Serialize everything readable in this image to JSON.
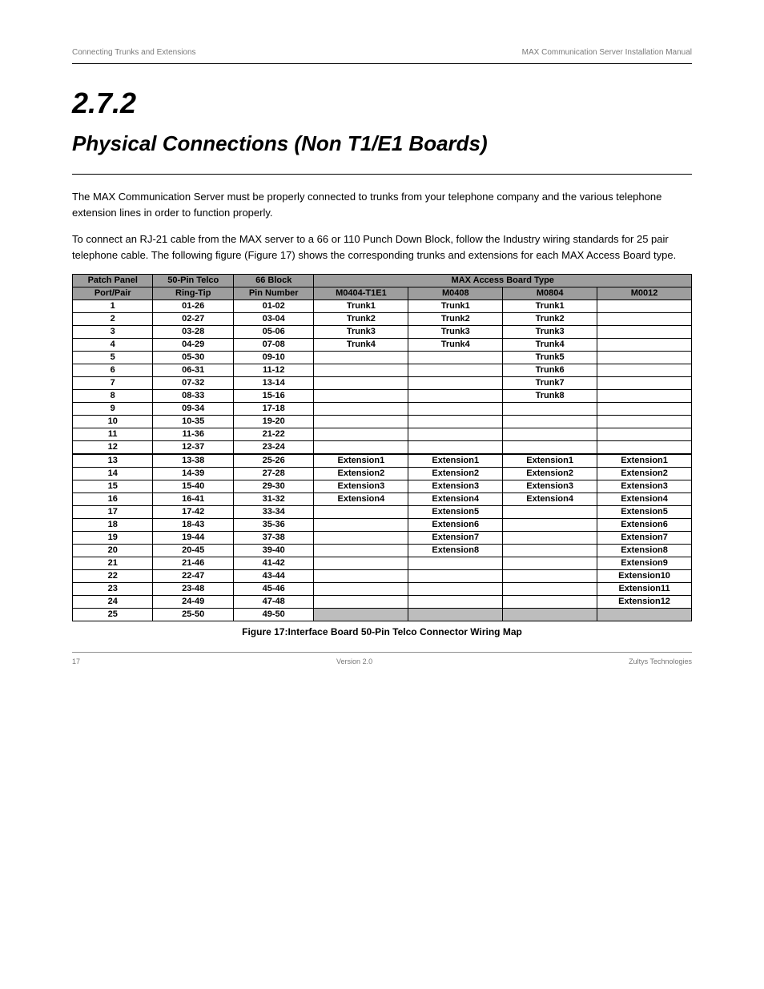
{
  "page": {
    "header_left": "Connecting Trunks and Extensions",
    "header_right": "MAX Communication Server Installation Manual",
    "section_number": "2.7.2",
    "section_title": "Physical Connections (Non T1/E1 Boards)",
    "para1": "The MAX Communication Server must be properly connected to trunks from your telephone company and the various telephone extension lines in order to function properly.",
    "para2": "To connect an RJ-21 cable from the MAX server to a 66 or 110 Punch Down Block, follow the Industry wiring standards for 25 pair telephone cable. The following figure (Figure 17) shows the corresponding trunks and extensions for each MAX Access Board type."
  },
  "table": {
    "headers": {
      "patch_panel": "Patch Panel",
      "telco": "50-Pin Telco",
      "block": "66 Block",
      "board_type": "MAX Access Board Type",
      "port_pair": "Port/Pair",
      "ring_tip": "Ring-Tip",
      "pin_number": "Pin Number",
      "c1": "M0404-T1E1",
      "c2": "M0408",
      "c3": "M0804",
      "c4": "M0012"
    },
    "rows": [
      {
        "pp": "1",
        "rt": "01-26",
        "pn": "01-02",
        "c1": "Trunk1",
        "c2": "Trunk1",
        "c3": "Trunk1",
        "c4": ""
      },
      {
        "pp": "2",
        "rt": "02-27",
        "pn": "03-04",
        "c1": "Trunk2",
        "c2": "Trunk2",
        "c3": "Trunk2",
        "c4": ""
      },
      {
        "pp": "3",
        "rt": "03-28",
        "pn": "05-06",
        "c1": "Trunk3",
        "c2": "Trunk3",
        "c3": "Trunk3",
        "c4": ""
      },
      {
        "pp": "4",
        "rt": "04-29",
        "pn": "07-08",
        "c1": "Trunk4",
        "c2": "Trunk4",
        "c3": "Trunk4",
        "c4": ""
      },
      {
        "pp": "5",
        "rt": "05-30",
        "pn": "09-10",
        "c1": "",
        "c2": "",
        "c3": "Trunk5",
        "c4": ""
      },
      {
        "pp": "6",
        "rt": "06-31",
        "pn": "11-12",
        "c1": "",
        "c2": "",
        "c3": "Trunk6",
        "c4": ""
      },
      {
        "pp": "7",
        "rt": "07-32",
        "pn": "13-14",
        "c1": "",
        "c2": "",
        "c3": "Trunk7",
        "c4": ""
      },
      {
        "pp": "8",
        "rt": "08-33",
        "pn": "15-16",
        "c1": "",
        "c2": "",
        "c3": "Trunk8",
        "c4": ""
      },
      {
        "pp": "9",
        "rt": "09-34",
        "pn": "17-18",
        "c1": "",
        "c2": "",
        "c3": "",
        "c4": ""
      },
      {
        "pp": "10",
        "rt": "10-35",
        "pn": "19-20",
        "c1": "",
        "c2": "",
        "c3": "",
        "c4": ""
      },
      {
        "pp": "11",
        "rt": "11-36",
        "pn": "21-22",
        "c1": "",
        "c2": "",
        "c3": "",
        "c4": ""
      },
      {
        "pp": "12",
        "rt": "12-37",
        "pn": "23-24",
        "c1": "",
        "c2": "",
        "c3": "",
        "c4": ""
      },
      {
        "pp": "13",
        "rt": "13-38",
        "pn": "25-26",
        "c1": "Extension1",
        "c2": "Extension1",
        "c3": "Extension1",
        "c4": "Extension1",
        "sep": true
      },
      {
        "pp": "14",
        "rt": "14-39",
        "pn": "27-28",
        "c1": "Extension2",
        "c2": "Extension2",
        "c3": "Extension2",
        "c4": "Extension2"
      },
      {
        "pp": "15",
        "rt": "15-40",
        "pn": "29-30",
        "c1": "Extension3",
        "c2": "Extension3",
        "c3": "Extension3",
        "c4": "Extension3"
      },
      {
        "pp": "16",
        "rt": "16-41",
        "pn": "31-32",
        "c1": "Extension4",
        "c2": "Extension4",
        "c3": "Extension4",
        "c4": "Extension4"
      },
      {
        "pp": "17",
        "rt": "17-42",
        "pn": "33-34",
        "c1": "",
        "c2": "Extension5",
        "c3": "",
        "c4": "Extension5"
      },
      {
        "pp": "18",
        "rt": "18-43",
        "pn": "35-36",
        "c1": "",
        "c2": "Extension6",
        "c3": "",
        "c4": "Extension6"
      },
      {
        "pp": "19",
        "rt": "19-44",
        "pn": "37-38",
        "c1": "",
        "c2": "Extension7",
        "c3": "",
        "c4": "Extension7"
      },
      {
        "pp": "20",
        "rt": "20-45",
        "pn": "39-40",
        "c1": "",
        "c2": "Extension8",
        "c3": "",
        "c4": "Extension8"
      },
      {
        "pp": "21",
        "rt": "21-46",
        "pn": "41-42",
        "c1": "",
        "c2": "",
        "c3": "",
        "c4": "Extension9"
      },
      {
        "pp": "22",
        "rt": "22-47",
        "pn": "43-44",
        "c1": "",
        "c2": "",
        "c3": "",
        "c4": "Extension10"
      },
      {
        "pp": "23",
        "rt": "23-48",
        "pn": "45-46",
        "c1": "",
        "c2": "",
        "c3": "",
        "c4": "Extension11"
      },
      {
        "pp": "24",
        "rt": "24-49",
        "pn": "47-48",
        "c1": "",
        "c2": "",
        "c3": "",
        "c4": "Extension12"
      },
      {
        "pp": "25",
        "rt": "25-50",
        "pn": "49-50",
        "c1": "gray",
        "c2": "gray",
        "c3": "gray",
        "c4": "gray"
      }
    ]
  },
  "figure_caption": "Figure 17:Interface Board 50-Pin Telco Connector Wiring Map",
  "footer": {
    "bottom_left": "17",
    "bottom_center": "Version 2.0",
    "bottom_right": "Zultys Technologies"
  }
}
